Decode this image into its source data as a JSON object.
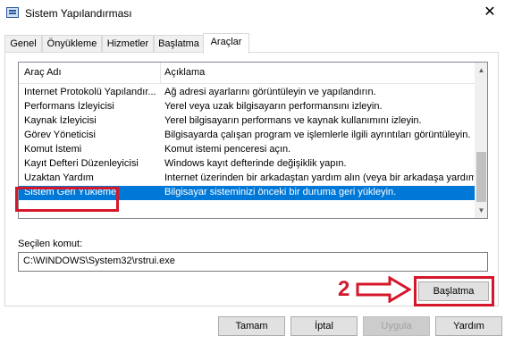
{
  "window": {
    "title": "Sistem Yapılandırması",
    "close_glyph": "✕"
  },
  "tabs": [
    {
      "label": "Genel"
    },
    {
      "label": "Önyükleme"
    },
    {
      "label": "Hizmetler"
    },
    {
      "label": "Başlatma"
    },
    {
      "label": "Araçlar",
      "active": true
    }
  ],
  "tools_list": {
    "columns": [
      "Araç Adı",
      "Açıklama"
    ],
    "rows": [
      {
        "name": "Internet Protokolü Yapılandır...",
        "description": "Ağ adresi ayarlarını görüntüleyin ve yapılandırın."
      },
      {
        "name": "Performans İzleyicisi",
        "description": "Yerel veya uzak bilgisayarın performansını izleyin."
      },
      {
        "name": "Kaynak İzleyicisi",
        "description": "Yerel bilgisayarın performans ve kaynak kullanımını izleyin."
      },
      {
        "name": "Görev Yöneticisi",
        "description": "Bilgisayarda çalışan program ve işlemlerle ilgili ayrıntıları görüntüleyin."
      },
      {
        "name": "Komut İstemi",
        "description": "Komut istemi penceresi açın."
      },
      {
        "name": "Kayıt Defteri Düzenleyicisi",
        "description": "Windows kayıt defterinde değişiklik yapın."
      },
      {
        "name": "Uzaktan Yardım",
        "description": "Internet üzerinden bir arkadaştan yardım alın (veya bir arkadaşa yardım"
      },
      {
        "name": "Sistem Geri Yükleme",
        "description": "Bilgisayar sisteminizi önceki bir duruma geri yükleyin.",
        "selected": true
      }
    ]
  },
  "command": {
    "label": "Seçilen komut:",
    "value": "C:\\WINDOWS\\System32\\rstrui.exe"
  },
  "buttons": {
    "launch": "Başlatma",
    "ok": "Tamam",
    "cancel": "İptal",
    "apply": "Uygula",
    "help": "Yardım"
  },
  "annotation": {
    "step_number": "2",
    "color": "#d4172a"
  },
  "colors": {
    "selection": "#0078d7"
  }
}
